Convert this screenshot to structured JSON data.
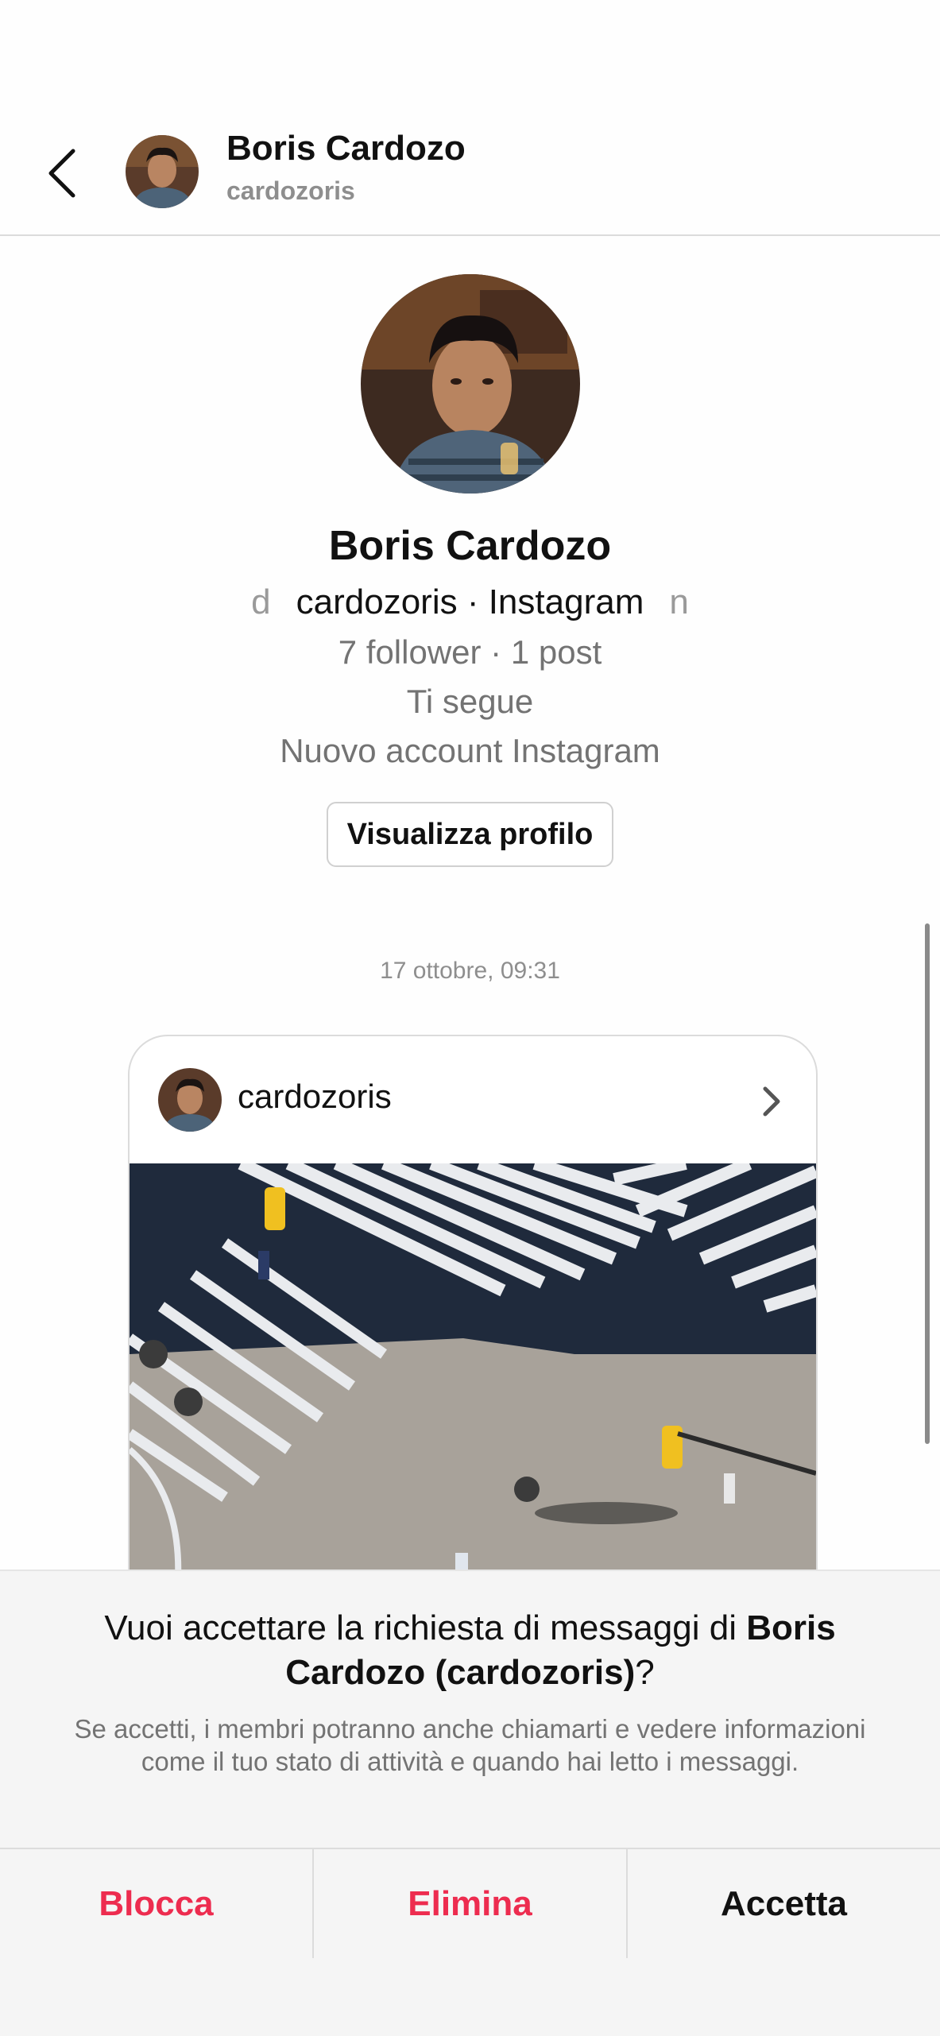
{
  "header": {
    "name": "Boris Cardozo",
    "username": "cardozoris"
  },
  "profile": {
    "name": "Boris Cardozo",
    "handle_left_fragment": "d",
    "handle_line": "cardozoris · Instagram",
    "handle_right_fragment": "n",
    "stats": "7 follower · 1 post",
    "follows_you": "Ti segue",
    "account_note": "Nuovo account Instagram",
    "view_profile_label": "Visualizza profilo"
  },
  "thread": {
    "timestamp": "17 ottobre, 09:31",
    "shared_post": {
      "username": "cardozoris"
    }
  },
  "request": {
    "question_prefix": "Vuoi accettare la richiesta di messaggi di ",
    "question_name": "Boris Cardozo (cardozoris)",
    "question_suffix": "?",
    "note": "Se accetti, i membri potranno anche chiamarti e vedere informazioni come il tuo stato di attività e quando hai letto i messaggi.",
    "block_label": "Blocca",
    "delete_label": "Elimina",
    "accept_label": "Accetta"
  },
  "colors": {
    "destructive": "#ed2c4f",
    "secondary_text": "#737373"
  }
}
